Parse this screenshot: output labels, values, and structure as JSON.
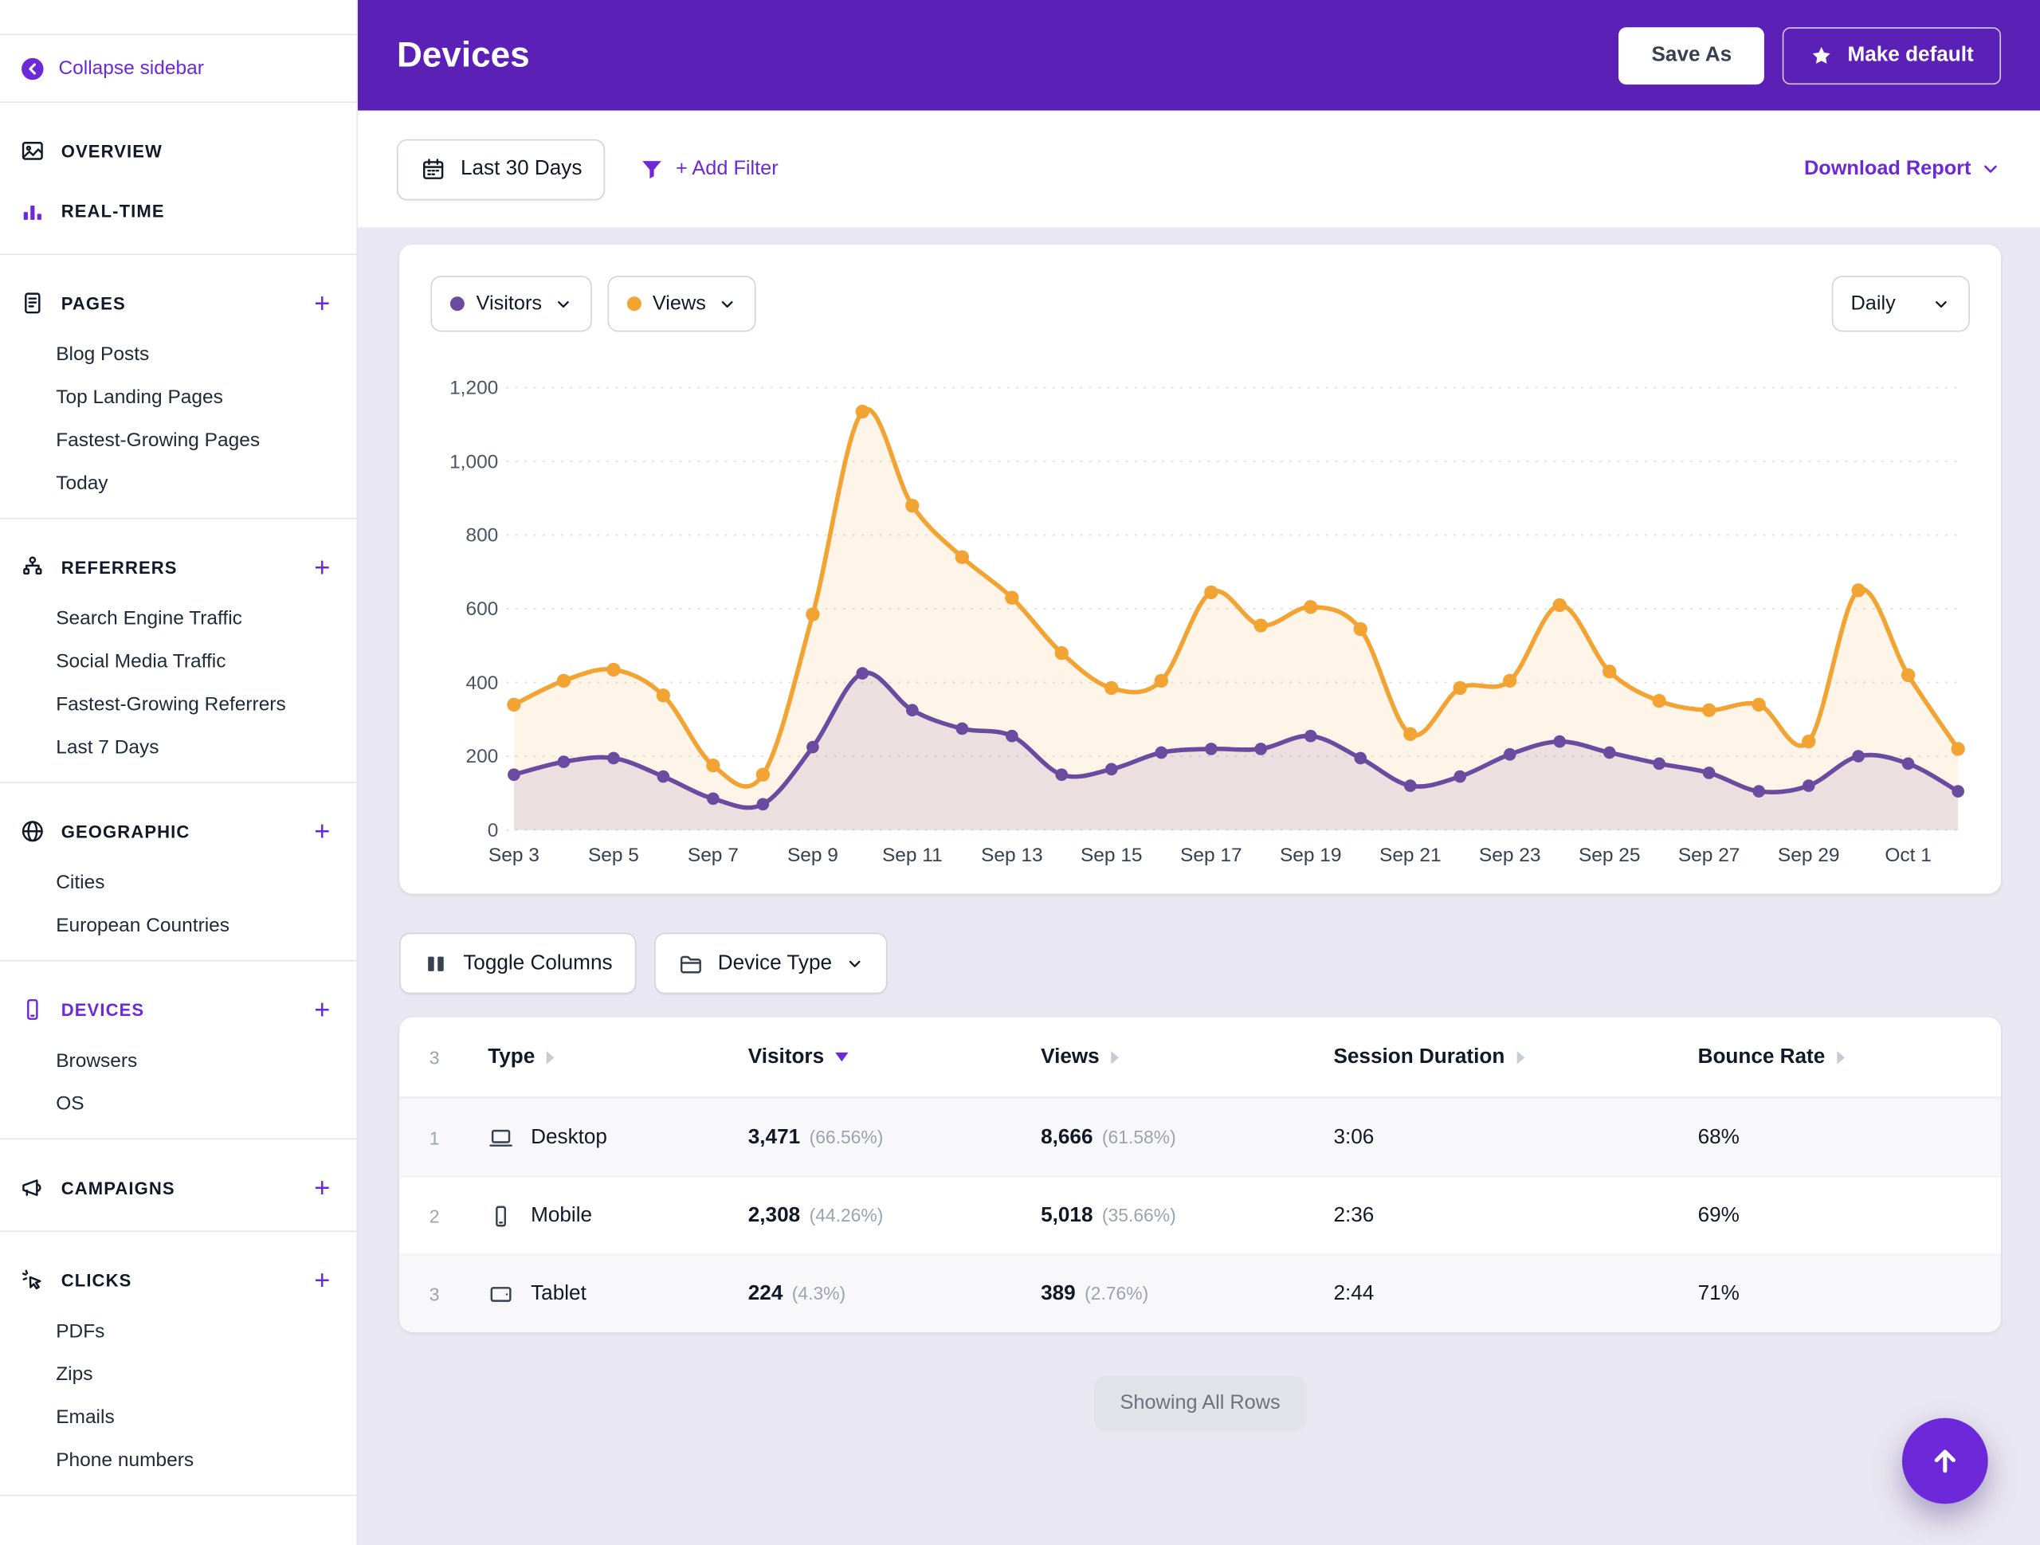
{
  "colors": {
    "accent": "#6D28D9",
    "header_bg": "#5B21B6",
    "content_bg": "#E9E7F1",
    "views_color": "#F2A331",
    "visitors_color": "#6A4B9F"
  },
  "sidebar": {
    "collapse_label": "Collapse sidebar",
    "sections": [
      {
        "items": [
          {
            "label": "OVERVIEW",
            "icon": "overview-icon"
          },
          {
            "label": "REAL-TIME",
            "icon": "realtime-icon"
          }
        ]
      },
      {
        "items": [
          {
            "label": "PAGES",
            "icon": "pages-icon",
            "plus": true,
            "children": [
              "Blog Posts",
              "Top Landing Pages",
              "Fastest-Growing Pages",
              "Today"
            ]
          }
        ]
      },
      {
        "items": [
          {
            "label": "REFERRERS",
            "icon": "referrers-icon",
            "plus": true,
            "children": [
              "Search Engine Traffic",
              "Social Media Traffic",
              "Fastest-Growing Referrers",
              "Last 7 Days"
            ]
          }
        ]
      },
      {
        "items": [
          {
            "label": "GEOGRAPHIC",
            "icon": "geographic-icon",
            "plus": true,
            "children": [
              "Cities",
              "European Countries"
            ]
          }
        ]
      },
      {
        "items": [
          {
            "label": "DEVICES",
            "icon": "devices-icon",
            "plus": true,
            "active": true,
            "children": [
              "Browsers",
              "OS"
            ]
          }
        ]
      },
      {
        "items": [
          {
            "label": "CAMPAIGNS",
            "icon": "campaigns-icon",
            "plus": true,
            "children": []
          }
        ]
      },
      {
        "items": [
          {
            "label": "CLICKS",
            "icon": "clicks-icon",
            "plus": true,
            "children": [
              "PDFs",
              "Zips",
              "Emails",
              "Phone numbers"
            ]
          }
        ]
      }
    ]
  },
  "header": {
    "title": "Devices",
    "save_as_label": "Save As",
    "make_default_label": "Make default"
  },
  "toolbar": {
    "date_range_label": "Last 30 Days",
    "add_filter_label": "+ Add Filter",
    "download_label": "Download Report"
  },
  "chart": {
    "legend": [
      {
        "label": "Visitors",
        "color": "#6A4B9F"
      },
      {
        "label": "Views",
        "color": "#F2A331"
      }
    ],
    "interval_label": "Daily"
  },
  "chart_data": {
    "type": "line",
    "title": "",
    "x": [
      "Sep 3",
      "Sep 4",
      "Sep 5",
      "Sep 6",
      "Sep 7",
      "Sep 8",
      "Sep 9",
      "Sep 10",
      "Sep 11",
      "Sep 12",
      "Sep 13",
      "Sep 14",
      "Sep 15",
      "Sep 16",
      "Sep 17",
      "Sep 18",
      "Sep 19",
      "Sep 20",
      "Sep 21",
      "Sep 22",
      "Sep 23",
      "Sep 24",
      "Sep 25",
      "Sep 26",
      "Sep 27",
      "Sep 28",
      "Sep 29",
      "Sep 30",
      "Oct 1",
      "Oct 2"
    ],
    "series": [
      {
        "name": "Visitors",
        "color": "#6A4B9F",
        "values": [
          150,
          185,
          195,
          145,
          85,
          70,
          225,
          425,
          325,
          275,
          255,
          150,
          165,
          210,
          220,
          220,
          255,
          195,
          120,
          145,
          205,
          240,
          210,
          180,
          155,
          105,
          120,
          200,
          180,
          105
        ]
      },
      {
        "name": "Views",
        "color": "#F2A331",
        "values": [
          340,
          405,
          435,
          365,
          175,
          150,
          585,
          1135,
          880,
          740,
          630,
          480,
          385,
          405,
          645,
          555,
          605,
          545,
          260,
          385,
          405,
          610,
          430,
          350,
          325,
          340,
          240,
          650,
          420,
          220
        ]
      }
    ],
    "ylim": [
      0,
      1200
    ],
    "yticks": [
      0,
      200,
      400,
      600,
      800,
      1000,
      1200
    ],
    "ytick_labels": [
      "0",
      "200",
      "400",
      "600",
      "800",
      "1,000",
      "1,200"
    ],
    "xtick_every": 2,
    "grid": "horizontal-dashed",
    "legend_position": "top-left",
    "smooth": true,
    "area": true
  },
  "table_controls": {
    "toggle_columns_label": "Toggle Columns",
    "device_type_label": "Device Type"
  },
  "table": {
    "row_count": "3",
    "columns": [
      {
        "label": "Type",
        "sort": "none"
      },
      {
        "label": "Visitors",
        "sort": "desc"
      },
      {
        "label": "Views",
        "sort": "none"
      },
      {
        "label": "Session Duration",
        "sort": "none"
      },
      {
        "label": "Bounce Rate",
        "sort": "none"
      }
    ],
    "rows": [
      {
        "index": "1",
        "icon": "desktop-icon",
        "type": "Desktop",
        "visitors": "3,471",
        "visitors_pct": "(66.56%)",
        "views": "8,666",
        "views_pct": "(61.58%)",
        "session_duration": "3:06",
        "bounce_rate": "68%"
      },
      {
        "index": "2",
        "icon": "mobile-icon",
        "type": "Mobile",
        "visitors": "2,308",
        "visitors_pct": "(44.26%)",
        "views": "5,018",
        "views_pct": "(35.66%)",
        "session_duration": "2:36",
        "bounce_rate": "69%"
      },
      {
        "index": "3",
        "icon": "tablet-icon",
        "type": "Tablet",
        "visitors": "224",
        "visitors_pct": "(4.3%)",
        "views": "389",
        "views_pct": "(2.76%)",
        "session_duration": "2:44",
        "bounce_rate": "71%"
      }
    ],
    "footer_label": "Showing All Rows"
  }
}
